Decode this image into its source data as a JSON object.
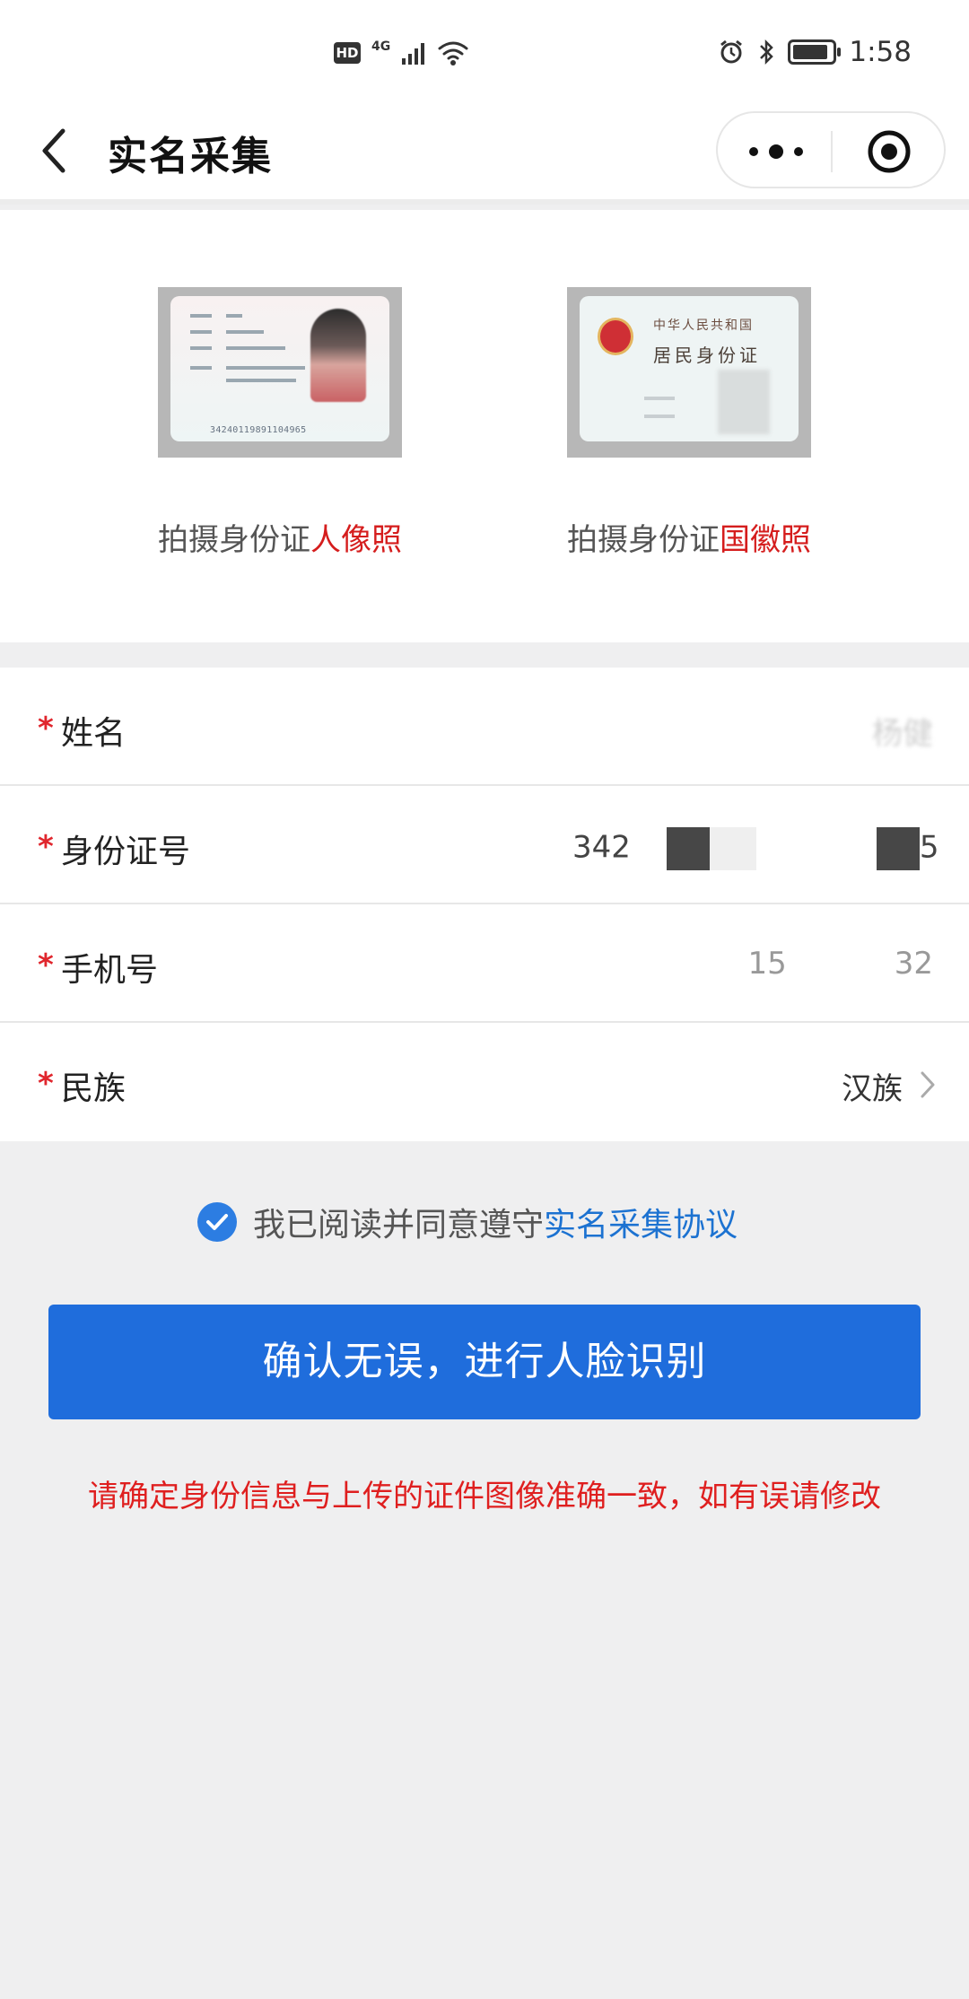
{
  "status_bar": {
    "hd": "HD",
    "network": "4G",
    "time": "1:58"
  },
  "nav": {
    "title": "实名采集"
  },
  "photos": {
    "front": {
      "caption_prefix": "拍摄身份证",
      "caption_highlight": "人像照",
      "card_number": "34240119891104965"
    },
    "back": {
      "caption_prefix": "拍摄身份证",
      "caption_highlight": "国徽照",
      "card_title": "中华人民共和国",
      "card_subtitle": "居民身份证"
    }
  },
  "form": {
    "required_mark": "*",
    "name": {
      "label": "姓名",
      "value": "杨健"
    },
    "id_number": {
      "label": "身份证号",
      "value_start": "342",
      "value_end": "5"
    },
    "phone": {
      "label": "手机号",
      "value_start": "15",
      "value_end": "32"
    },
    "ethnicity": {
      "label": "民族",
      "value": "汉族"
    }
  },
  "agreement": {
    "checked": true,
    "text": "我已阅读并同意遵守",
    "link": "实名采集协议"
  },
  "confirm_button": "确认无误，进行人脸识别",
  "warning": "请确定身份信息与上传的证件图像准确一致，如有误请修改",
  "colors": {
    "primary": "#1f6ddc",
    "required": "#e0262d",
    "link": "#1c72d1",
    "warning": "#df1f1f",
    "background": "#efeff0"
  },
  "icons": [
    "back-arrow-icon",
    "more-icon",
    "target-icon",
    "check-icon",
    "chevron-right-icon"
  ]
}
